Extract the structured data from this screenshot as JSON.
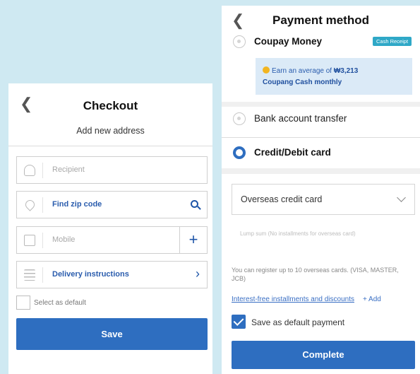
{
  "checkout": {
    "title": "Checkout",
    "subtitle": "Add new address",
    "recipient_placeholder": "Recipient",
    "zip_label": "Find zip code",
    "mobile_placeholder": "Mobile",
    "delivery_label": "Delivery instructions",
    "default_label": "Select as default",
    "save_label": "Save"
  },
  "payment": {
    "title": "Payment method",
    "coupay_label": "Coupay Money",
    "badge": "Cash Receipt",
    "promo_prefix": "Earn an average of ",
    "promo_amount": "₩3,213",
    "promo_line2": "Coupang Cash monthly",
    "bank_label": "Bank account transfer",
    "card_label": "Credit/Debit card",
    "card_select": "Overseas credit card",
    "installment_placeholder": "Lump sum (No installments for overseas card)",
    "note": "You can register up to 10 overseas cards. (VISA, MASTER, JCB)",
    "link_text": "Interest-free installments and discounts",
    "add_text": "+ Add",
    "save_default": "Save as default payment",
    "complete_label": "Complete"
  },
  "colors": {
    "background": "#cfe9f2",
    "primary": "#2e6ec0",
    "link": "#2a5cad",
    "badge": "#2fa8c7"
  },
  "icons": [
    "back-chevron-icon",
    "person-icon",
    "location-pin-icon",
    "search-icon",
    "phone-icon",
    "plus-icon",
    "list-icon",
    "chevron-right-icon",
    "coin-icon",
    "chevron-down-icon",
    "check-icon"
  ]
}
